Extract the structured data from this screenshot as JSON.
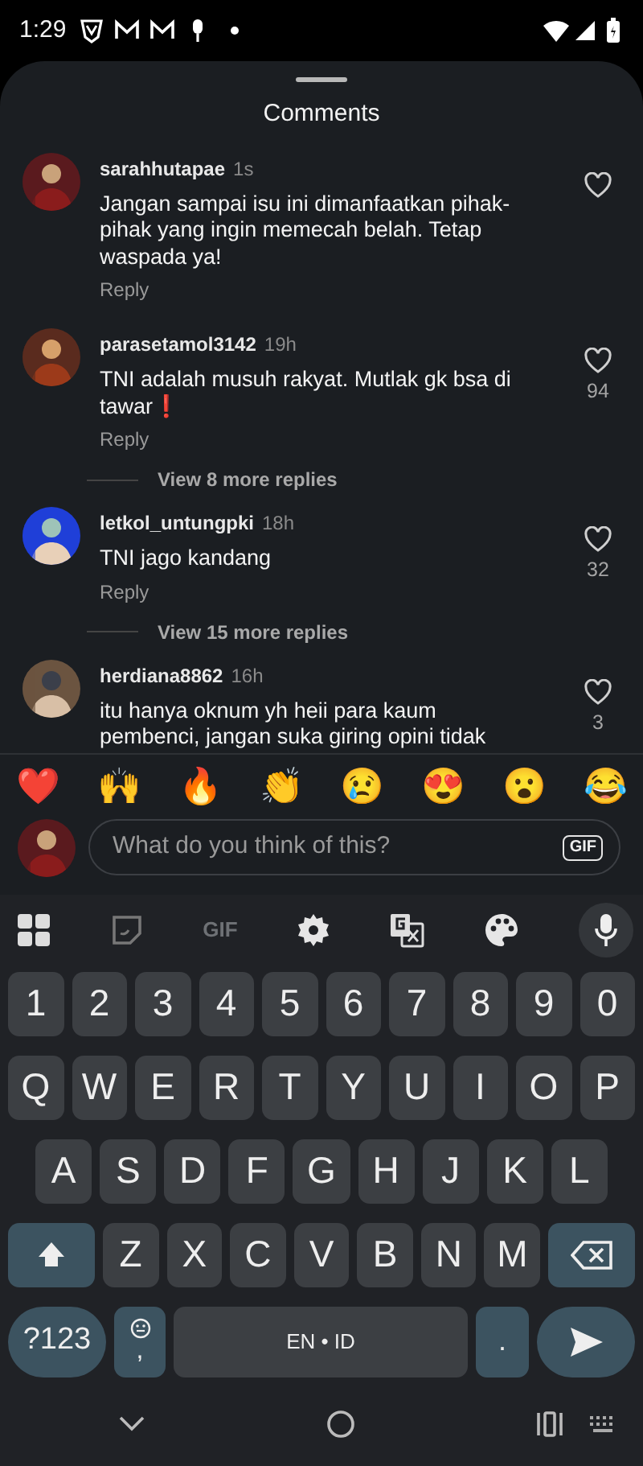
{
  "status_bar": {
    "time": "1:29"
  },
  "sheet": {
    "title": "Comments"
  },
  "comments": [
    {
      "user": "sarahhutapae",
      "time": "1s",
      "text": "Jangan sampai isu ini dimanfaatkan pihak-pihak yang ingin memecah belah. Tetap waspada ya!",
      "reply": "Reply",
      "liked": false
    },
    {
      "user": "parasetamol3142",
      "time": "19h",
      "text": "TNI adalah musuh rakyat. Mutlak gk bsa di tawar❗",
      "reply": "Reply",
      "liked": false,
      "likes": "94",
      "view_replies": "View 8 more replies"
    },
    {
      "user": "letkol_untungpki",
      "time": "18h",
      "text": "TNI jago kandang",
      "reply": "Reply",
      "liked": false,
      "likes": "32",
      "view_replies": "View 15 more replies"
    },
    {
      "user": "herdiana8862",
      "time": "16h",
      "text": "itu hanya oknum yh heii para kaum pembenci, jangan suka giring opini tidak",
      "liked": false,
      "likes": "3"
    }
  ],
  "reactions": [
    "❤️",
    "🙌",
    "🔥",
    "👏",
    "😢",
    "😍",
    "😮",
    "😂"
  ],
  "composer": {
    "placeholder": "What do you think of this?",
    "gif_label": "GIF"
  },
  "keyboard_toolbar": {
    "gif_label": "GIF"
  },
  "keyboard": {
    "rows": [
      {
        "keys": [
          {
            "kind": "letter",
            "label": "1"
          },
          {
            "kind": "letter",
            "label": "2"
          },
          {
            "kind": "letter",
            "label": "3"
          },
          {
            "kind": "letter",
            "label": "4"
          },
          {
            "kind": "letter",
            "label": "5"
          },
          {
            "kind": "letter",
            "label": "6"
          },
          {
            "kind": "letter",
            "label": "7"
          },
          {
            "kind": "letter",
            "label": "8"
          },
          {
            "kind": "letter",
            "label": "9"
          },
          {
            "kind": "letter",
            "label": "0"
          }
        ]
      },
      {
        "keys": [
          {
            "kind": "letter",
            "label": "Q"
          },
          {
            "kind": "letter",
            "label": "W"
          },
          {
            "kind": "letter",
            "label": "E"
          },
          {
            "kind": "letter",
            "label": "R"
          },
          {
            "kind": "letter",
            "label": "T"
          },
          {
            "kind": "letter",
            "label": "Y"
          },
          {
            "kind": "letter",
            "label": "U"
          },
          {
            "kind": "letter",
            "label": "I"
          },
          {
            "kind": "letter",
            "label": "O"
          },
          {
            "kind": "letter",
            "label": "P"
          }
        ]
      },
      {
        "keys": [
          {
            "kind": "letter",
            "label": "A"
          },
          {
            "kind": "letter",
            "label": "S"
          },
          {
            "kind": "letter",
            "label": "D"
          },
          {
            "kind": "letter",
            "label": "F"
          },
          {
            "kind": "letter",
            "label": "G"
          },
          {
            "kind": "letter",
            "label": "H"
          },
          {
            "kind": "letter",
            "label": "J"
          },
          {
            "kind": "letter",
            "label": "K"
          },
          {
            "kind": "letter",
            "label": "L"
          }
        ]
      },
      {
        "keys": [
          {
            "kind": "shift"
          },
          {
            "kind": "letter",
            "label": "Z"
          },
          {
            "kind": "letter",
            "label": "X"
          },
          {
            "kind": "letter",
            "label": "C"
          },
          {
            "kind": "letter",
            "label": "V"
          },
          {
            "kind": "letter",
            "label": "B"
          },
          {
            "kind": "letter",
            "label": "N"
          },
          {
            "kind": "letter",
            "label": "M"
          },
          {
            "kind": "backspace"
          }
        ]
      },
      {
        "keys": [
          {
            "kind": "symbols",
            "label": "?123"
          },
          {
            "kind": "emoji",
            "label": ","
          },
          {
            "kind": "space",
            "label": "EN • ID"
          },
          {
            "kind": "period",
            "label": "."
          },
          {
            "kind": "send"
          }
        ]
      }
    ]
  }
}
